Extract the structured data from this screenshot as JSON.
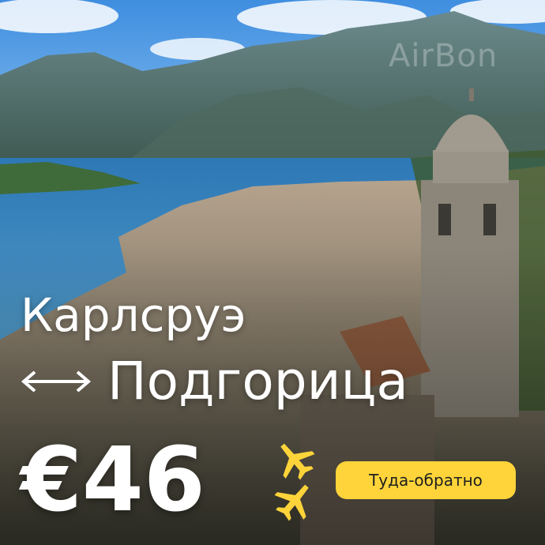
{
  "ad": {
    "watermark": "AirBon",
    "origin_city": "Карлсруэ",
    "destination_city": "Подгорица",
    "price": "€46",
    "trip_type": "Туда-обратно",
    "icons": {
      "route": "double-arrow-icon",
      "flight": "airplane-icon"
    },
    "colors": {
      "badge": "#ffd43a",
      "text": "#ffffff",
      "sky": "#5da3e6",
      "water": "#2f7fb8"
    }
  }
}
